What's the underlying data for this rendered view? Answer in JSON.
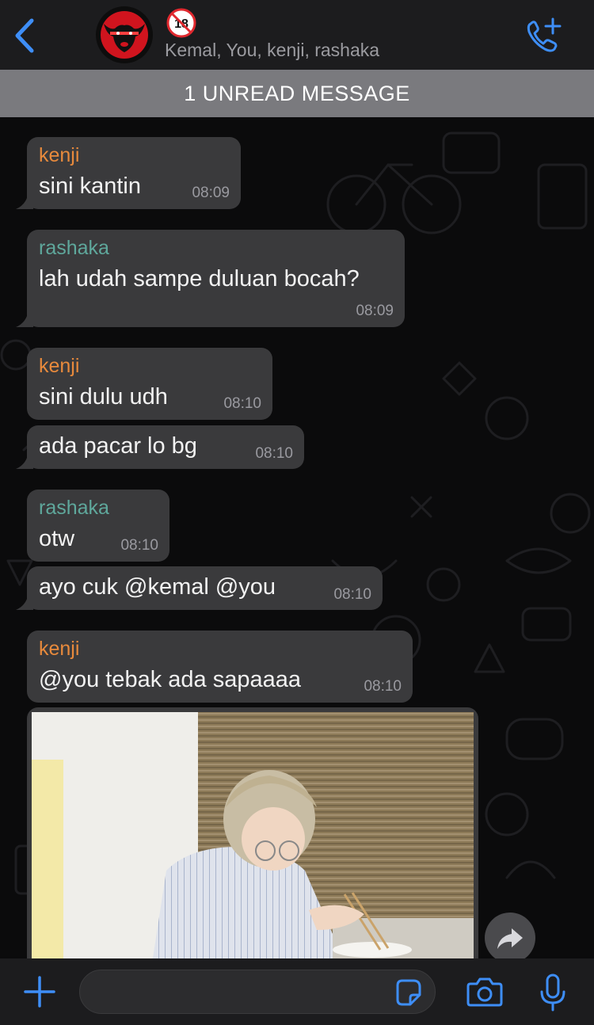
{
  "header": {
    "members": "Kemal, You, kenji, rashaka",
    "badge_text": "18"
  },
  "unread_banner": "1 UNREAD MESSAGE",
  "messages": [
    {
      "sender": "kenji",
      "text": "sini kantin",
      "time": "08:09"
    },
    {
      "sender": "rashaka",
      "text": "lah udah sampe duluan bocah?",
      "time": "08:09"
    },
    {
      "sender": "kenji",
      "text": "sini dulu udh",
      "time": "08:10"
    },
    {
      "sender": "",
      "text": "ada pacar lo bg",
      "time": "08:10"
    },
    {
      "sender": "rashaka",
      "text": "otw",
      "time": "08:10"
    },
    {
      "sender": "",
      "text": "ayo cuk @kemal @you",
      "time": "08:10"
    },
    {
      "sender": "kenji",
      "text": "@you tebak ada sapaaaa",
      "time": "08:10"
    }
  ],
  "colors": {
    "accent": "#3e8ef7",
    "kenji": "#e88a3c",
    "rashaka": "#5fa89c",
    "bubble": "#3a3a3c"
  },
  "icons": {
    "back": "chevron-left-icon",
    "call": "phone-plus-icon",
    "forward": "forward-arrow-icon",
    "plus": "plus-icon",
    "sticker": "sticker-icon",
    "camera": "camera-icon",
    "mic": "microphone-icon"
  }
}
